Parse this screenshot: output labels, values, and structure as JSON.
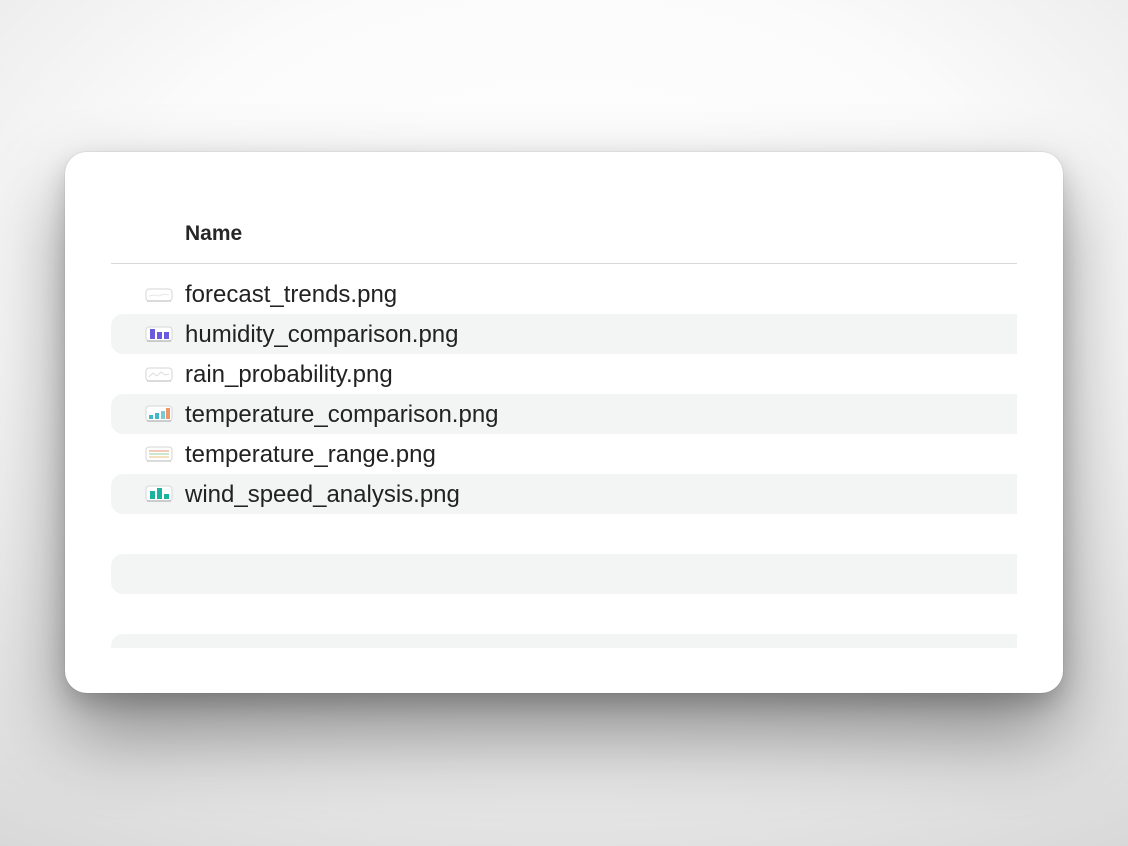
{
  "list": {
    "column_header": "Name",
    "files": [
      {
        "name": "forecast_trends.png",
        "icon": "line-chart-thumbnail-icon"
      },
      {
        "name": "humidity_comparison.png",
        "icon": "purple-bar-chart-thumbnail-icon"
      },
      {
        "name": "rain_probability.png",
        "icon": "line-chart-thumbnail-icon"
      },
      {
        "name": "temperature_comparison.png",
        "icon": "teal-orange-bar-chart-thumbnail-icon"
      },
      {
        "name": "temperature_range.png",
        "icon": "range-chart-thumbnail-icon"
      },
      {
        "name": "wind_speed_analysis.png",
        "icon": "teal-bar-chart-thumbnail-icon"
      }
    ]
  },
  "colors": {
    "row_stripe": "#f3f4f4",
    "text": "#222222",
    "purple_bars": "#6a5ae0",
    "teal": "#1ab3a0",
    "orange": "#f0956a"
  }
}
